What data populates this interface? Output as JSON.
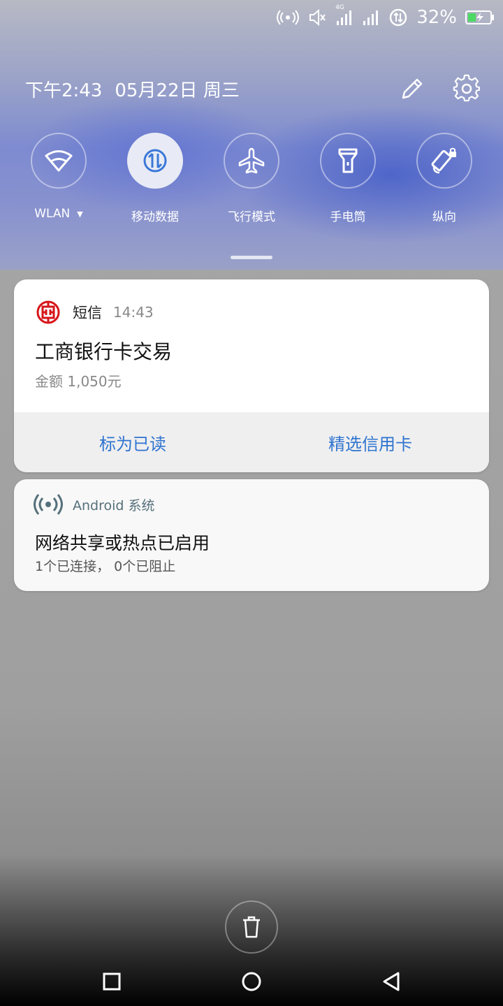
{
  "status_bar": {
    "battery_percent": "32%",
    "network_type": "4G",
    "icons": [
      "hotspot-icon",
      "vibrate-icon",
      "signal-4g-icon",
      "signal-icon",
      "data-saver-icon",
      "battery-charging-icon"
    ]
  },
  "header": {
    "time": "下午2:43",
    "date": "05月22日 周三",
    "edit_icon": "pencil-icon",
    "settings_icon": "gear-icon"
  },
  "quick_tiles": [
    {
      "label": "WLAN",
      "icon": "wifi-icon",
      "active": false
    },
    {
      "label": "移动数据",
      "icon": "mobile-data-icon",
      "active": true
    },
    {
      "label": "飞行模式",
      "icon": "airplane-icon",
      "active": false
    },
    {
      "label": "手电筒",
      "icon": "flashlight-icon",
      "active": false
    },
    {
      "label": "纵向",
      "icon": "rotation-lock-icon",
      "active": false
    }
  ],
  "notifications": [
    {
      "app": "短信",
      "time": "14:43",
      "title": "工商银行卡交易",
      "body": "金额 1,050元",
      "actions": [
        "标为已读",
        "精选信用卡"
      ],
      "icon": "icbc-logo-icon",
      "icon_color": "#d7151a"
    },
    {
      "app": "Android 系统",
      "title": "网络共享或热点已启用",
      "body": "1个已连接， 0个已阻止",
      "icon": "hotspot-icon"
    }
  ],
  "colors": {
    "action_text": "#2f74d0",
    "active_tile": "#e8ebf5"
  }
}
